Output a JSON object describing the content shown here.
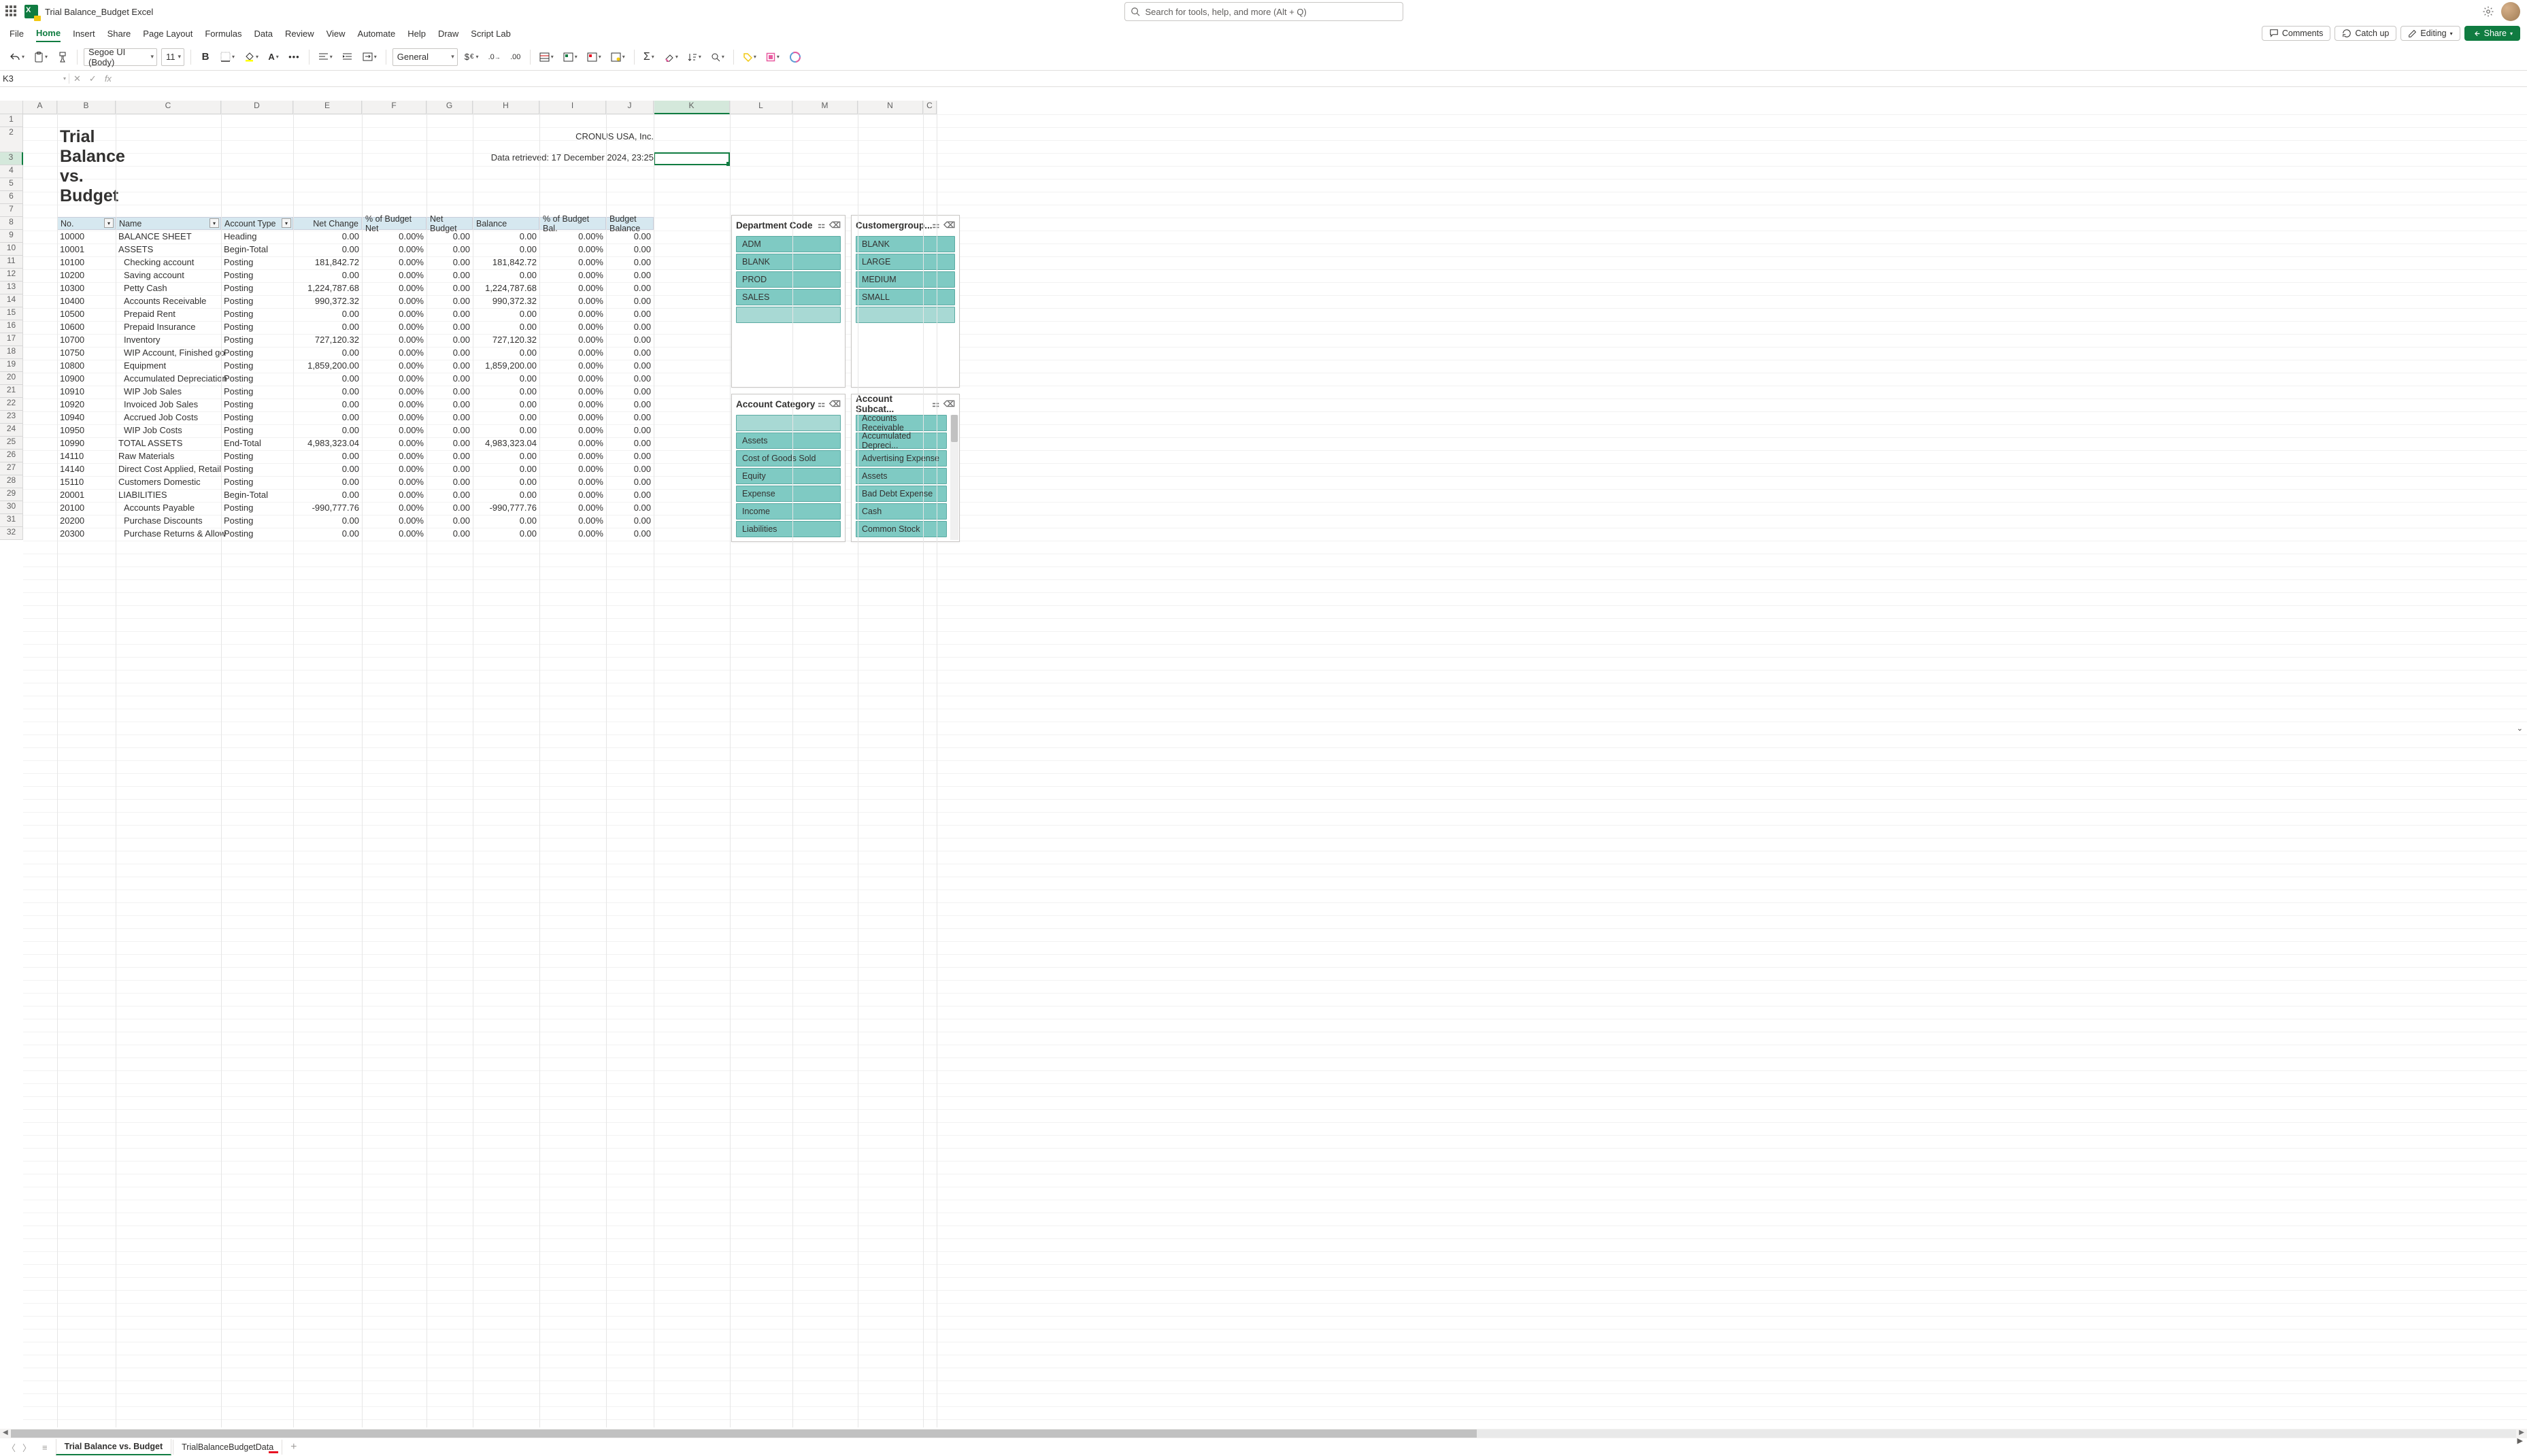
{
  "title_bar": {
    "document_name": "Trial Balance_Budget Excel",
    "search_placeholder": "Search for tools, help, and more (Alt + Q)"
  },
  "ribbon": {
    "tabs": [
      "File",
      "Home",
      "Insert",
      "Share",
      "Page Layout",
      "Formulas",
      "Data",
      "Review",
      "View",
      "Automate",
      "Help",
      "Draw",
      "Script Lab"
    ],
    "active_tab": "Home",
    "right_buttons": {
      "comments": "Comments",
      "catchup": "Catch up",
      "editing": "Editing",
      "share": "Share"
    }
  },
  "toolbar": {
    "font_name": "Segoe UI (Body)",
    "font_size": "11",
    "number_format": "General"
  },
  "name_box": "K3",
  "columns": [
    {
      "letter": "A",
      "width": 50
    },
    {
      "letter": "B",
      "width": 86
    },
    {
      "letter": "C",
      "width": 155
    },
    {
      "letter": "D",
      "width": 106
    },
    {
      "letter": "E",
      "width": 101
    },
    {
      "letter": "F",
      "width": 95
    },
    {
      "letter": "G",
      "width": 68
    },
    {
      "letter": "H",
      "width": 98
    },
    {
      "letter": "I",
      "width": 98
    },
    {
      "letter": "J",
      "width": 70
    },
    {
      "letter": "K",
      "width": 112
    },
    {
      "letter": "L",
      "width": 92
    },
    {
      "letter": "M",
      "width": 96
    },
    {
      "letter": "N",
      "width": 96
    },
    {
      "letter": "C2",
      "width": 20,
      "label": "C"
    }
  ],
  "sheet": {
    "title": "Trial Balance vs. Budget",
    "company": "CRONUS USA, Inc.",
    "retrieved": "Data retrieved: 17 December 2024, 23:25",
    "headers": {
      "no": "No.",
      "name": "Name",
      "account_type": "Account Type",
      "net_change": "Net Change",
      "pct_budget_net": "% of Budget Net",
      "net_budget": "Net Budget",
      "balance": "Balance",
      "pct_budget_bal": "% of Budget Bal.",
      "budget_balance": "Budget Balance"
    },
    "rows": [
      {
        "no": "10000",
        "name": "BALANCE SHEET",
        "type": "Heading",
        "nc": "0.00",
        "pbn": "0.00%",
        "nb": "0.00",
        "bal": "0.00",
        "pbb": "0.00%",
        "bb": "0.00"
      },
      {
        "no": "10001",
        "name": "ASSETS",
        "type": "Begin-Total",
        "nc": "0.00",
        "pbn": "0.00%",
        "nb": "0.00",
        "bal": "0.00",
        "pbb": "0.00%",
        "bb": "0.00"
      },
      {
        "no": "10100",
        "name": "Checking account",
        "type": "Posting",
        "nc": "181,842.72",
        "pbn": "0.00%",
        "nb": "0.00",
        "bal": "181,842.72",
        "pbb": "0.00%",
        "bb": "0.00",
        "indent": true
      },
      {
        "no": "10200",
        "name": "Saving account",
        "type": "Posting",
        "nc": "0.00",
        "pbn": "0.00%",
        "nb": "0.00",
        "bal": "0.00",
        "pbb": "0.00%",
        "bb": "0.00",
        "indent": true
      },
      {
        "no": "10300",
        "name": "Petty Cash",
        "type": "Posting",
        "nc": "1,224,787.68",
        "pbn": "0.00%",
        "nb": "0.00",
        "bal": "1,224,787.68",
        "pbb": "0.00%",
        "bb": "0.00",
        "indent": true
      },
      {
        "no": "10400",
        "name": "Accounts Receivable",
        "type": "Posting",
        "nc": "990,372.32",
        "pbn": "0.00%",
        "nb": "0.00",
        "bal": "990,372.32",
        "pbb": "0.00%",
        "bb": "0.00",
        "indent": true
      },
      {
        "no": "10500",
        "name": "Prepaid Rent",
        "type": "Posting",
        "nc": "0.00",
        "pbn": "0.00%",
        "nb": "0.00",
        "bal": "0.00",
        "pbb": "0.00%",
        "bb": "0.00",
        "indent": true
      },
      {
        "no": "10600",
        "name": "Prepaid Insurance",
        "type": "Posting",
        "nc": "0.00",
        "pbn": "0.00%",
        "nb": "0.00",
        "bal": "0.00",
        "pbb": "0.00%",
        "bb": "0.00",
        "indent": true
      },
      {
        "no": "10700",
        "name": "Inventory",
        "type": "Posting",
        "nc": "727,120.32",
        "pbn": "0.00%",
        "nb": "0.00",
        "bal": "727,120.32",
        "pbb": "0.00%",
        "bb": "0.00",
        "indent": true
      },
      {
        "no": "10750",
        "name": "WIP Account, Finished go",
        "type": "Posting",
        "nc": "0.00",
        "pbn": "0.00%",
        "nb": "0.00",
        "bal": "0.00",
        "pbb": "0.00%",
        "bb": "0.00",
        "indent": true
      },
      {
        "no": "10800",
        "name": "Equipment",
        "type": "Posting",
        "nc": "1,859,200.00",
        "pbn": "0.00%",
        "nb": "0.00",
        "bal": "1,859,200.00",
        "pbb": "0.00%",
        "bb": "0.00",
        "indent": true
      },
      {
        "no": "10900",
        "name": "Accumulated Depreciation",
        "type": "Posting",
        "nc": "0.00",
        "pbn": "0.00%",
        "nb": "0.00",
        "bal": "0.00",
        "pbb": "0.00%",
        "bb": "0.00",
        "indent": true
      },
      {
        "no": "10910",
        "name": "WIP Job Sales",
        "type": "Posting",
        "nc": "0.00",
        "pbn": "0.00%",
        "nb": "0.00",
        "bal": "0.00",
        "pbb": "0.00%",
        "bb": "0.00",
        "indent": true
      },
      {
        "no": "10920",
        "name": "Invoiced Job Sales",
        "type": "Posting",
        "nc": "0.00",
        "pbn": "0.00%",
        "nb": "0.00",
        "bal": "0.00",
        "pbb": "0.00%",
        "bb": "0.00",
        "indent": true
      },
      {
        "no": "10940",
        "name": "Accrued Job Costs",
        "type": "Posting",
        "nc": "0.00",
        "pbn": "0.00%",
        "nb": "0.00",
        "bal": "0.00",
        "pbb": "0.00%",
        "bb": "0.00",
        "indent": true
      },
      {
        "no": "10950",
        "name": "WIP Job Costs",
        "type": "Posting",
        "nc": "0.00",
        "pbn": "0.00%",
        "nb": "0.00",
        "bal": "0.00",
        "pbb": "0.00%",
        "bb": "0.00",
        "indent": true
      },
      {
        "no": "10990",
        "name": "TOTAL ASSETS",
        "type": "End-Total",
        "nc": "4,983,323.04",
        "pbn": "0.00%",
        "nb": "0.00",
        "bal": "4,983,323.04",
        "pbb": "0.00%",
        "bb": "0.00"
      },
      {
        "no": "14110",
        "name": "Raw Materials",
        "type": "Posting",
        "nc": "0.00",
        "pbn": "0.00%",
        "nb": "0.00",
        "bal": "0.00",
        "pbb": "0.00%",
        "bb": "0.00"
      },
      {
        "no": "14140",
        "name": "Direct Cost Applied, Retail",
        "type": "Posting",
        "nc": "0.00",
        "pbn": "0.00%",
        "nb": "0.00",
        "bal": "0.00",
        "pbb": "0.00%",
        "bb": "0.00"
      },
      {
        "no": "15110",
        "name": "Customers Domestic",
        "type": "Posting",
        "nc": "0.00",
        "pbn": "0.00%",
        "nb": "0.00",
        "bal": "0.00",
        "pbb": "0.00%",
        "bb": "0.00"
      },
      {
        "no": "20001",
        "name": "LIABILITIES",
        "type": "Begin-Total",
        "nc": "0.00",
        "pbn": "0.00%",
        "nb": "0.00",
        "bal": "0.00",
        "pbb": "0.00%",
        "bb": "0.00"
      },
      {
        "no": "20100",
        "name": "Accounts Payable",
        "type": "Posting",
        "nc": "-990,777.76",
        "pbn": "0.00%",
        "nb": "0.00",
        "bal": "-990,777.76",
        "pbb": "0.00%",
        "bb": "0.00",
        "indent": true
      },
      {
        "no": "20200",
        "name": "Purchase Discounts",
        "type": "Posting",
        "nc": "0.00",
        "pbn": "0.00%",
        "nb": "0.00",
        "bal": "0.00",
        "pbb": "0.00%",
        "bb": "0.00",
        "indent": true
      },
      {
        "no": "20300",
        "name": "Purchase Returns & Allow",
        "type": "Posting",
        "nc": "0.00",
        "pbn": "0.00%",
        "nb": "0.00",
        "bal": "0.00",
        "pbb": "0.00%",
        "bb": "0.00",
        "indent": true
      }
    ]
  },
  "slicers": {
    "dept": {
      "title": "Department Code",
      "items": [
        "ADM",
        "BLANK",
        "PROD",
        "SALES",
        ""
      ]
    },
    "cust": {
      "title": "Customergroup...",
      "items": [
        "BLANK",
        "LARGE",
        "MEDIUM",
        "SMALL",
        ""
      ]
    },
    "acccat": {
      "title": "Account Category",
      "items": [
        "",
        "Assets",
        "Cost of Goods Sold",
        "Equity",
        "Expense",
        "Income",
        "Liabilities"
      ]
    },
    "accsub": {
      "title": "Account Subcat...",
      "items": [
        "Accounts Receivable",
        "Accumulated Depreci...",
        "Advertising Expense",
        "Assets",
        "Bad Debt Expense",
        "Cash",
        "Common Stock"
      ]
    }
  },
  "sheet_tabs": {
    "active": "Trial Balance vs. Budget",
    "other": "TrialBalanceBudgetData"
  }
}
